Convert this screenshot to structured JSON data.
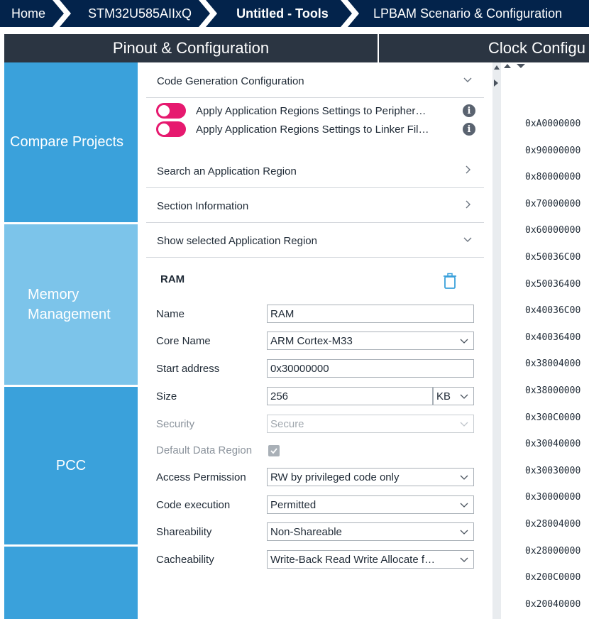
{
  "breadcrumb": {
    "home": "Home",
    "device": "STM32U585AIIxQ",
    "project": "Untitled - Tools",
    "scenario": "LPBAM Scenario & Configuration"
  },
  "tabs": {
    "pinout": "Pinout & Configuration",
    "clock": "Clock Configu"
  },
  "nav": {
    "compare": "Compare Projects",
    "memory_line1": "Memory",
    "memory_line2": "Management",
    "pcc": "PCC"
  },
  "sections": {
    "code_gen": "Code Generation Configuration",
    "search": "Search an Application Region",
    "section_info": "Section Information",
    "show_selected": "Show selected Application Region"
  },
  "toggles": {
    "peripherals": "Apply Application Regions Settings to Peripher…",
    "linker": "Apply Application Regions Settings to Linker Fil…",
    "info_glyph": "i"
  },
  "region": {
    "title": "RAM",
    "labels": {
      "name": "Name",
      "core": "Core Name",
      "start": "Start address",
      "size": "Size",
      "security": "Security",
      "default_data": "Default Data Region",
      "access": "Access Permission",
      "exec": "Code execution",
      "share": "Shareability",
      "cache": "Cacheability"
    },
    "values": {
      "name": "RAM",
      "core": "ARM Cortex-M33",
      "start": "0x30000000",
      "size": "256",
      "size_unit": "KB",
      "security": "Secure",
      "default_data_checked": true,
      "access": "RW by privileged code only",
      "exec": "Permitted",
      "share": "Non-Shareable",
      "cache": "Write-Back Read Write Allocate f…"
    }
  },
  "address_list": [
    "0xA0000000",
    "0x90000000",
    "0x80000000",
    "0x70000000",
    "0x60000000",
    "0x50036C00",
    "0x50036400",
    "0x40036C00",
    "0x40036400",
    "0x38004000",
    "0x38000000",
    "0x300C0000",
    "0x30040000",
    "0x30030000",
    "0x30000000",
    "0x28004000",
    "0x28000000",
    "0x200C0000",
    "0x20040000"
  ],
  "colors": {
    "breadcrumb_bg": "#03234b",
    "tab_bg": "#2b3542",
    "nav_blue": "#3aa1db",
    "nav_selected": "#7cc4ea",
    "toggle_pink": "#e6196f",
    "trash_blue": "#3aa1db"
  }
}
